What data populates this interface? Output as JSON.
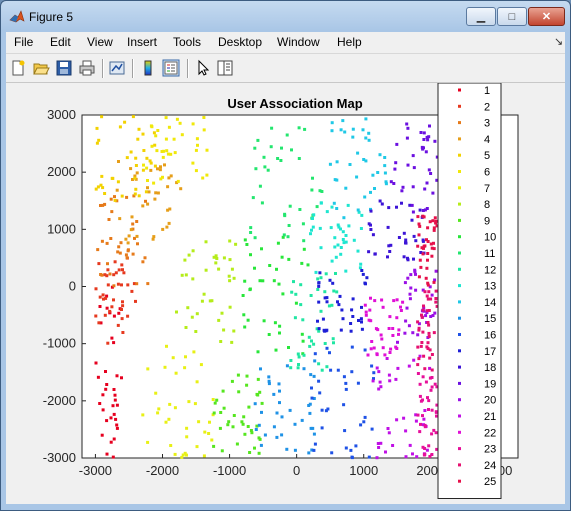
{
  "window": {
    "title": "Figure 5"
  },
  "menu": [
    "File",
    "Edit",
    "View",
    "Insert",
    "Tools",
    "Desktop",
    "Window",
    "Help"
  ],
  "toolbar_icons": [
    "new-figure-icon",
    "open-file-icon",
    "save-icon",
    "print-icon",
    "link-plot-icon",
    "colorbar-icon",
    "legend-icon",
    "pointer-icon",
    "property-editor-icon"
  ],
  "chart_data": {
    "type": "scatter",
    "title": "User Association Map",
    "xlabel": "",
    "ylabel": "",
    "xlim": [
      -3200,
      3300
    ],
    "ylim": [
      -3000,
      3000
    ],
    "xticks": [
      "-3000",
      "-2000",
      "-1000",
      "0",
      "1000",
      "2000",
      "3000"
    ],
    "yticks": [
      "3000",
      "2000",
      "1000",
      "0",
      "-1000",
      "-2000",
      "-3000"
    ],
    "grid": false,
    "legend_position": "right (overlapping axes, top)",
    "marker": "square",
    "series": [
      {
        "name": "1",
        "color": "#e6001f",
        "x_range": [
          -3000,
          -2600
        ],
        "y_range": [
          -3000,
          0
        ]
      },
      {
        "name": "2",
        "color": "#e6391f",
        "x_range": [
          -3000,
          -2400
        ],
        "y_range": [
          -1000,
          500
        ]
      },
      {
        "name": "3",
        "color": "#e67a1a",
        "x_range": [
          -3000,
          -2200
        ],
        "y_range": [
          0,
          1600
        ]
      },
      {
        "name": "4",
        "color": "#e69e1a",
        "x_range": [
          -2700,
          -1700
        ],
        "y_range": [
          700,
          2200
        ]
      },
      {
        "name": "5",
        "color": "#f2d200",
        "x_range": [
          -3000,
          -2100
        ],
        "y_range": [
          1500,
          3000
        ]
      },
      {
        "name": "6",
        "color": "#f0e80a",
        "x_range": [
          -2300,
          -1300
        ],
        "y_range": [
          1800,
          3000
        ]
      },
      {
        "name": "7",
        "color": "#e8f015",
        "x_range": [
          -2300,
          -1200
        ],
        "y_range": [
          -3000,
          -1000
        ]
      },
      {
        "name": "8",
        "color": "#b5ec1a",
        "x_range": [
          -1800,
          -900
        ],
        "y_range": [
          -1000,
          800
        ]
      },
      {
        "name": "9",
        "color": "#55e61f",
        "x_range": [
          -1300,
          -500
        ],
        "y_range": [
          -3000,
          -1500
        ]
      },
      {
        "name": "10",
        "color": "#28e63a",
        "x_range": [
          -800,
          200
        ],
        "y_range": [
          -1200,
          1000
        ]
      },
      {
        "name": "11",
        "color": "#23e66e",
        "x_range": [
          -700,
          400
        ],
        "y_range": [
          800,
          3000
        ]
      },
      {
        "name": "12",
        "color": "#20e6a3",
        "x_range": [
          -100,
          600
        ],
        "y_range": [
          -1500,
          300
        ]
      },
      {
        "name": "13",
        "color": "#1fe6d0",
        "x_range": [
          200,
          1000
        ],
        "y_range": [
          200,
          1500
        ]
      },
      {
        "name": "14",
        "color": "#1fc8e6",
        "x_range": [
          500,
          1400
        ],
        "y_range": [
          1200,
          3000
        ]
      },
      {
        "name": "15",
        "color": "#1f92e6",
        "x_range": [
          -700,
          300
        ],
        "y_range": [
          -3000,
          -1200
        ]
      },
      {
        "name": "16",
        "color": "#1f52e6",
        "x_range": [
          200,
          1200
        ],
        "y_range": [
          -3000,
          -1000
        ]
      },
      {
        "name": "17",
        "color": "#1f1fd6",
        "x_range": [
          300,
          1100
        ],
        "y_range": [
          -800,
          300
        ]
      },
      {
        "name": "18",
        "color": "#3c14d6",
        "x_range": [
          1000,
          1900
        ],
        "y_range": [
          400,
          1500
        ]
      },
      {
        "name": "19",
        "color": "#6b10e0",
        "x_range": [
          1400,
          2100
        ],
        "y_range": [
          1300,
          3000
        ]
      },
      {
        "name": "20",
        "color": "#9a10e6",
        "x_range": [
          1500,
          2200
        ],
        "y_range": [
          -1000,
          400
        ]
      },
      {
        "name": "21",
        "color": "#c010e6",
        "x_range": [
          1100,
          2000
        ],
        "y_range": [
          -3000,
          -1200
        ]
      },
      {
        "name": "22",
        "color": "#e010d6",
        "x_range": [
          1000,
          1600
        ],
        "y_range": [
          -1200,
          -200
        ]
      },
      {
        "name": "23",
        "color": "#e6109a",
        "x_range": [
          1800,
          2100
        ],
        "y_range": [
          -3000,
          -1500
        ]
      },
      {
        "name": "24",
        "color": "#e61070",
        "x_range": [
          1800,
          2100
        ],
        "y_range": [
          -1500,
          0
        ]
      },
      {
        "name": "25",
        "color": "#e6104a",
        "x_range": [
          1800,
          2100
        ],
        "y_range": [
          0,
          1400
        ]
      }
    ]
  }
}
